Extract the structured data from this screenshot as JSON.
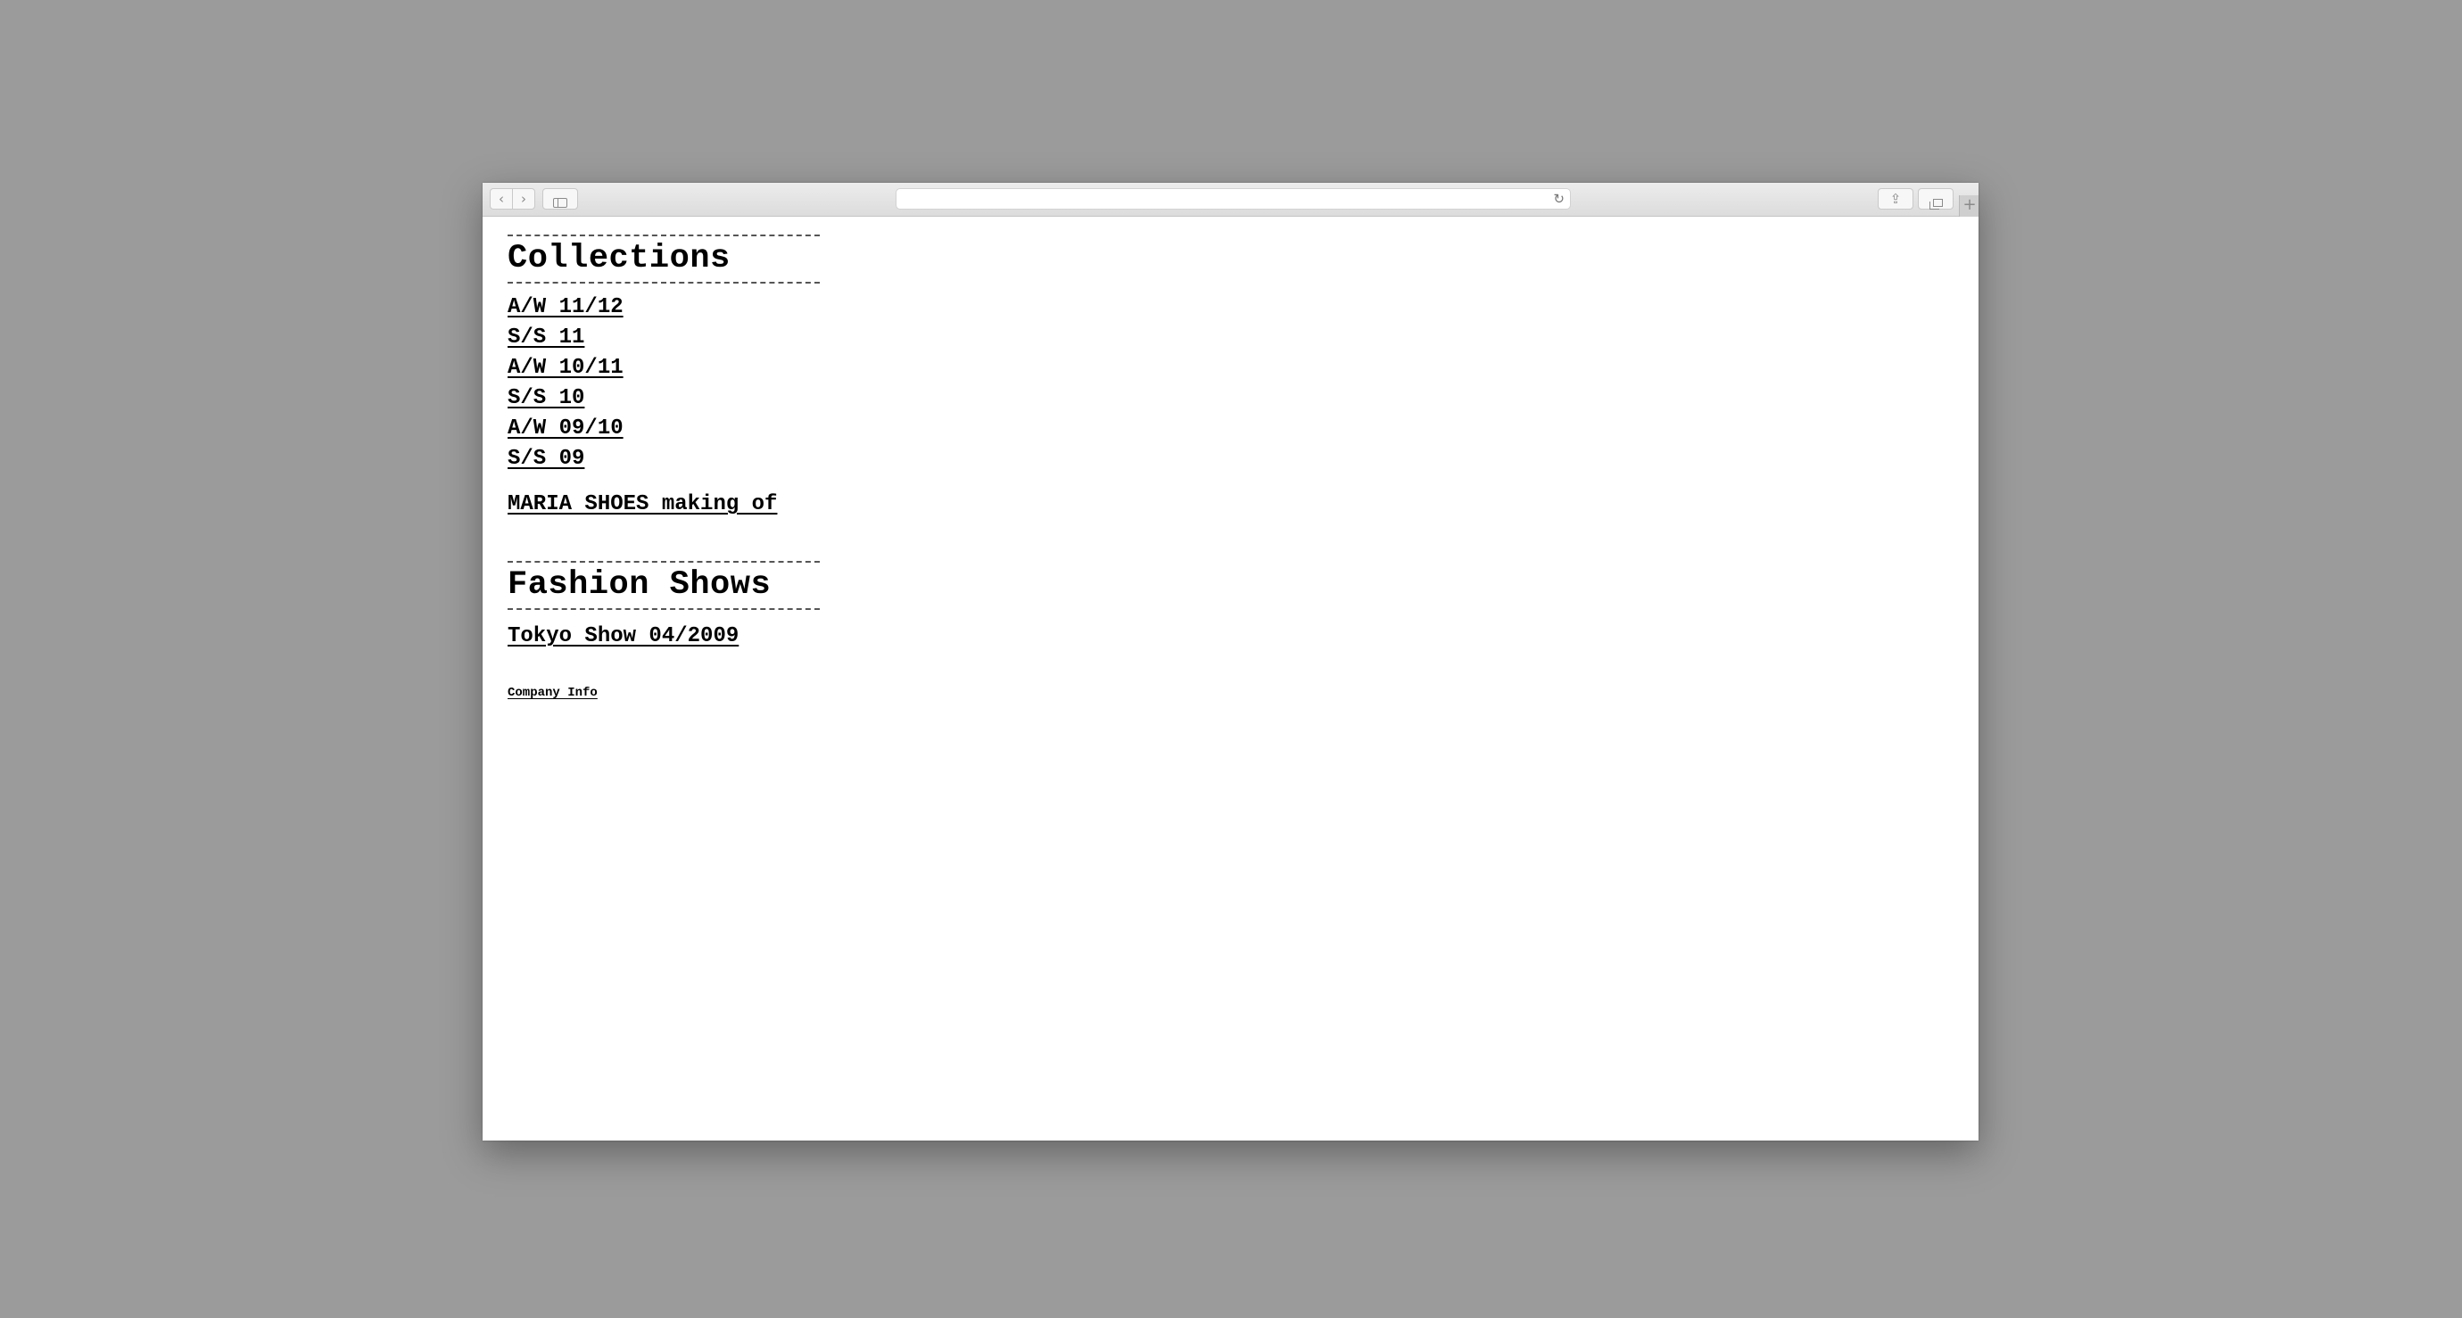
{
  "browser": {
    "address": "",
    "back_icon": "chevron-left-icon",
    "forward_icon": "chevron-right-icon",
    "reload_icon": "reload-icon",
    "newtab_icon": "plus-icon"
  },
  "collections": {
    "title": "Collections",
    "items": [
      {
        "label": "A/W 11/12"
      },
      {
        "label": "S/S 11"
      },
      {
        "label": "A/W 10/11"
      },
      {
        "label": "S/S 10"
      },
      {
        "label": "A/W 09/10"
      },
      {
        "label": "S/S 09"
      }
    ],
    "making_of": "MARIA SHOES making of"
  },
  "fashion_shows": {
    "title": "Fashion Shows",
    "items": [
      {
        "label": "Tokyo Show 04/2009"
      }
    ]
  },
  "footer": {
    "company_info": "Company Info"
  }
}
